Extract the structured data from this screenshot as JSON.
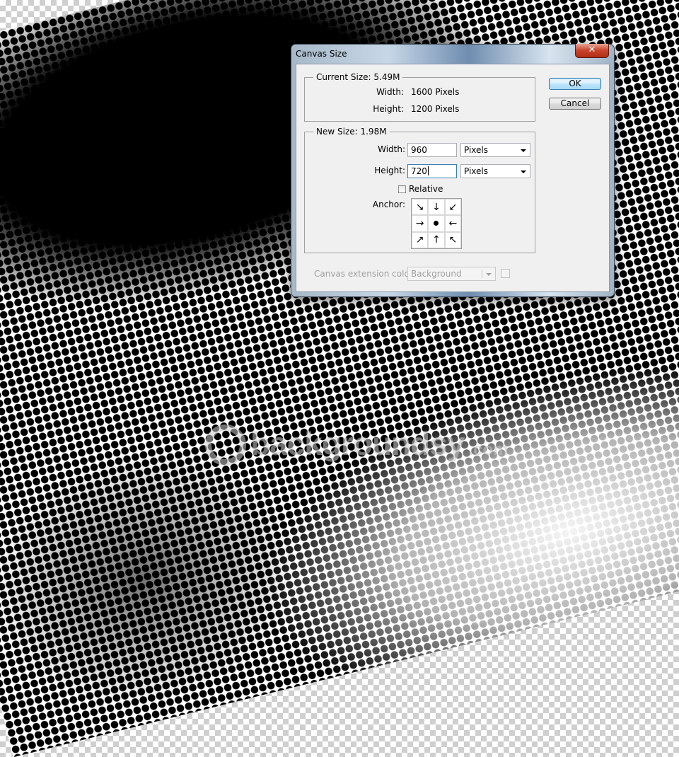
{
  "dialog": {
    "title": "Canvas Size",
    "close_glyph": "✕",
    "ok_label": "OK",
    "cancel_label": "Cancel"
  },
  "current_size": {
    "legend": "Current Size: 5.49M",
    "width_label": "Width:",
    "width_value": "1600 Pixels",
    "height_label": "Height:",
    "height_value": "1200 Pixels"
  },
  "new_size": {
    "legend": "New Size: 1.98M",
    "width_label": "Width:",
    "width_value": "960",
    "width_unit": "Pixels",
    "height_label": "Height:",
    "height_value": "720",
    "height_unit": "Pixels",
    "relative_label": "Relative",
    "relative_checked": false,
    "anchor_label": "Anchor:",
    "anchor_arrows": [
      "↘",
      "↓",
      "↙",
      "→",
      "",
      "←",
      "↗",
      "↑",
      "↖"
    ],
    "anchor_selected": "center"
  },
  "extension": {
    "label": "Canvas extension color:",
    "value": "Background"
  },
  "watermark": {
    "text": "backgroundsy",
    "tld": ".com"
  },
  "colors": {
    "default_button_border": "#3c7fb1",
    "close_button": "#c7432a"
  }
}
